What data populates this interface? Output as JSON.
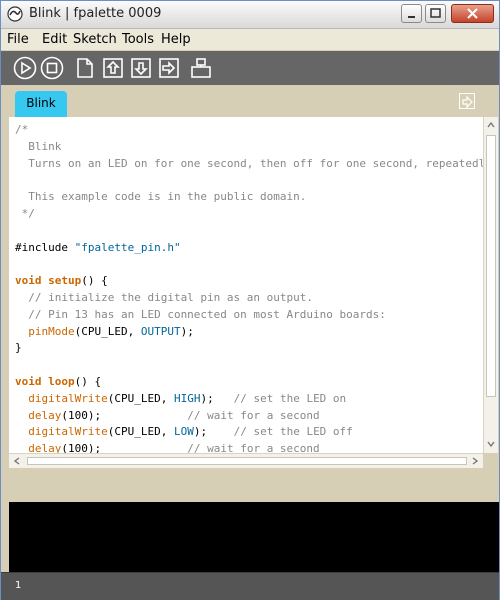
{
  "window": {
    "title": "Blink | fpalette 0009"
  },
  "menu": {
    "items": [
      "File",
      "Edit",
      "Sketch",
      "Tools",
      "Help"
    ]
  },
  "toolbar": {
    "buttons": [
      "run",
      "stop",
      "new",
      "open",
      "save",
      "upload",
      "serial-monitor"
    ]
  },
  "tab": {
    "label": "Blink"
  },
  "code": {
    "lines": [
      [
        {
          "t": "/*",
          "c": "comment"
        }
      ],
      [
        {
          "t": "  Blink",
          "c": "comment"
        }
      ],
      [
        {
          "t": "  Turns on an LED on for one second, then off for one second, repeatedly.",
          "c": "comment"
        }
      ],
      [
        {
          "t": "",
          "c": "plain"
        }
      ],
      [
        {
          "t": "  This example code is in the public domain.",
          "c": "comment"
        }
      ],
      [
        {
          "t": " */",
          "c": "comment"
        }
      ],
      [
        {
          "t": "",
          "c": "plain"
        }
      ],
      [
        {
          "t": "#include ",
          "c": "plain"
        },
        {
          "t": "\"fpalette_pin.h\"",
          "c": "str"
        }
      ],
      [
        {
          "t": "",
          "c": "plain"
        }
      ],
      [
        {
          "t": "void ",
          "c": "kw"
        },
        {
          "t": "setup",
          "c": "kw"
        },
        {
          "t": "() {",
          "c": "plain"
        }
      ],
      [
        {
          "t": "  // initialize the digital pin as an output.",
          "c": "comment"
        }
      ],
      [
        {
          "t": "  // Pin 13 has an LED connected on most Arduino boards:",
          "c": "comment"
        }
      ],
      [
        {
          "t": "  ",
          "c": "plain"
        },
        {
          "t": "pinMode",
          "c": "func"
        },
        {
          "t": "(CPU_LED, ",
          "c": "plain"
        },
        {
          "t": "OUTPUT",
          "c": "const"
        },
        {
          "t": ");",
          "c": "plain"
        }
      ],
      [
        {
          "t": "}",
          "c": "plain"
        }
      ],
      [
        {
          "t": "",
          "c": "plain"
        }
      ],
      [
        {
          "t": "void ",
          "c": "kw"
        },
        {
          "t": "loop",
          "c": "kw"
        },
        {
          "t": "() {",
          "c": "plain"
        }
      ],
      [
        {
          "t": "  ",
          "c": "plain"
        },
        {
          "t": "digitalWrite",
          "c": "func"
        },
        {
          "t": "(CPU_LED, ",
          "c": "plain"
        },
        {
          "t": "HIGH",
          "c": "const"
        },
        {
          "t": ");   ",
          "c": "plain"
        },
        {
          "t": "// set the LED on",
          "c": "comment"
        }
      ],
      [
        {
          "t": "  ",
          "c": "plain"
        },
        {
          "t": "delay",
          "c": "func"
        },
        {
          "t": "(100);             ",
          "c": "plain"
        },
        {
          "t": "// wait for a second",
          "c": "comment"
        }
      ],
      [
        {
          "t": "  ",
          "c": "plain"
        },
        {
          "t": "digitalWrite",
          "c": "func"
        },
        {
          "t": "(CPU_LED, ",
          "c": "plain"
        },
        {
          "t": "LOW",
          "c": "const"
        },
        {
          "t": ");    ",
          "c": "plain"
        },
        {
          "t": "// set the LED off",
          "c": "comment"
        }
      ],
      [
        {
          "t": "  ",
          "c": "plain"
        },
        {
          "t": "delay",
          "c": "func"
        },
        {
          "t": "(100);             ",
          "c": "plain"
        },
        {
          "t": "// wait for a second",
          "c": "comment"
        }
      ]
    ]
  },
  "status": {
    "line_number": "1"
  }
}
